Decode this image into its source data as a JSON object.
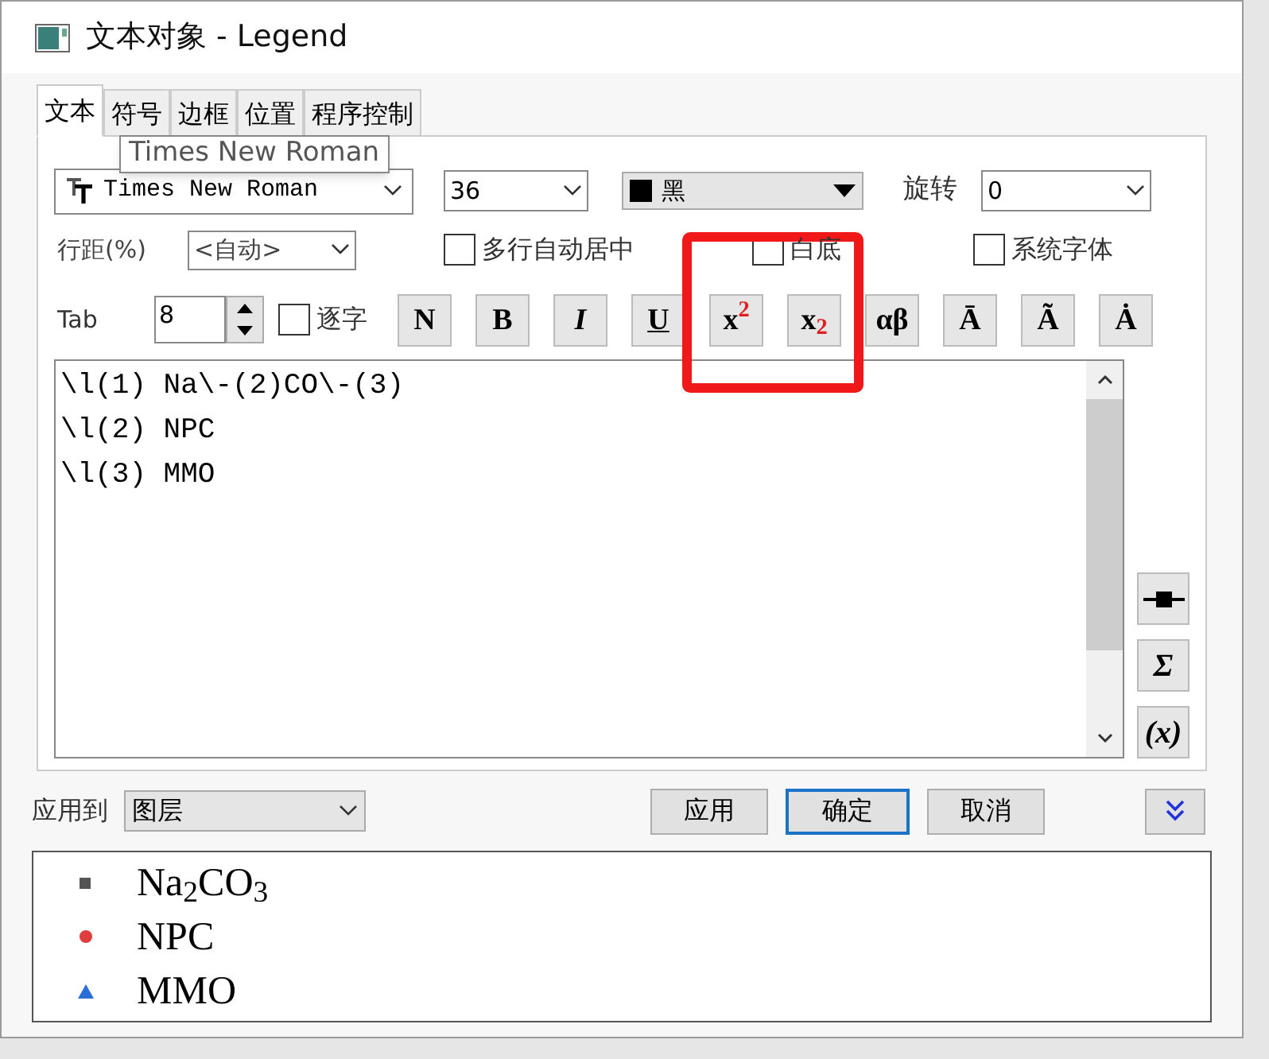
{
  "window": {
    "title": "文本对象 - Legend"
  },
  "tabs": [
    {
      "label": "文本",
      "selected": true
    },
    {
      "label": "符号",
      "selected": false
    },
    {
      "label": "边框",
      "selected": false
    },
    {
      "label": "位置",
      "selected": false
    },
    {
      "label": "程序控制",
      "selected": false
    }
  ],
  "tooltip": "Times New Roman",
  "font": {
    "value": "Times New Roman"
  },
  "size": {
    "value": "36"
  },
  "color": {
    "label": "黑",
    "color": "#000000"
  },
  "rotation": {
    "label": "旋转",
    "value": "0"
  },
  "line_spacing": {
    "label": "行距(%)",
    "value": "<自动>"
  },
  "options": [
    {
      "label": "多行自动居中",
      "checked": false
    },
    {
      "label": "白底",
      "checked": false
    },
    {
      "label": "系统字体",
      "checked": false
    }
  ],
  "tab_field": {
    "label": "Tab",
    "value": "8"
  },
  "per_char": {
    "label": "逐字",
    "checked": false
  },
  "format_buttons": [
    {
      "label": "N"
    },
    {
      "label": "B"
    },
    {
      "label": "I"
    },
    {
      "label": "U"
    },
    {
      "label": "x$^{2}$"
    },
    {
      "label": "x$_{2}$"
    },
    {
      "label": "αβ"
    },
    {
      "label": "Ā"
    },
    {
      "label": "Ã"
    },
    {
      "label": "Ȧ"
    }
  ],
  "highlight": {
    "on": true
  },
  "editor": {
    "lines": [
      "\\l(1) Na\\-(2)CO\\-(3)",
      "\\l(2) NPC",
      "\\l(3) MMO"
    ]
  },
  "side_buttons": [
    {
      "kind": "icon"
    },
    {
      "kind": "text",
      "label": "Σ"
    },
    {
      "kind": "text",
      "label": "(x)"
    }
  ],
  "apply_to": {
    "label": "应用到",
    "value": "图层"
  },
  "buttons": [
    {
      "label": "应用",
      "selected": false
    },
    {
      "label": "确定",
      "selected": true
    },
    {
      "label": "取消",
      "selected": false
    }
  ],
  "preview": [
    {
      "text": "Na$_{2}$CO$_{3}$",
      "kind": "square",
      "color": "#555555"
    },
    {
      "text": "NPC",
      "kind": "circle",
      "color": "#e03c3c"
    },
    {
      "text": "MMO",
      "kind": "triangle",
      "color": "#2a6fd6"
    }
  ]
}
